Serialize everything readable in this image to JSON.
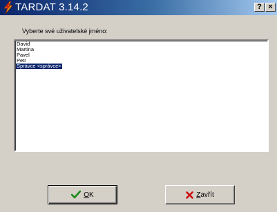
{
  "window": {
    "title": "TARDAT 3.14.2",
    "help_label": "?",
    "close_label": "×"
  },
  "prompt": "Vyberte své uživatelské jméno:",
  "users": [
    {
      "label": "David",
      "selected": false
    },
    {
      "label": "Martina",
      "selected": false
    },
    {
      "label": "Pavel",
      "selected": false
    },
    {
      "label": "Petr",
      "selected": false
    },
    {
      "label": "Správce <správce>",
      "selected": true
    }
  ],
  "buttons": {
    "ok": {
      "accel": "O",
      "rest": "K",
      "icon": "check-icon",
      "icon_color": "#1a8a1a"
    },
    "close": {
      "accel": "Z",
      "rest": "avřít",
      "icon": "x-icon",
      "icon_color": "#cc1010"
    }
  }
}
